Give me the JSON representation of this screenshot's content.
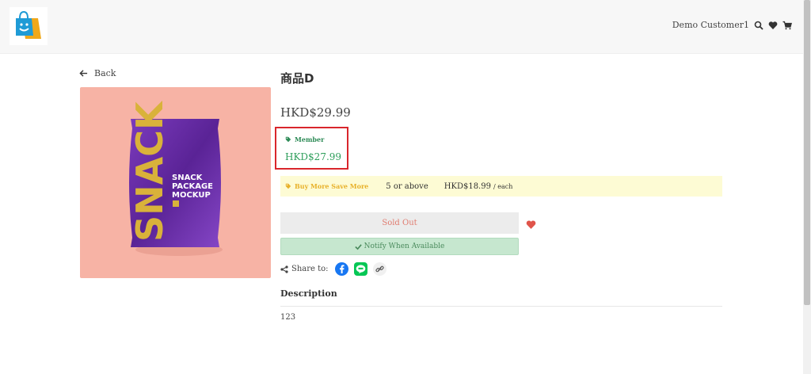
{
  "header": {
    "user_name": "Demo Customer1"
  },
  "product": {
    "back_label": "Back",
    "title": "商品D",
    "price": "HKD$29.99",
    "image_text": {
      "brand_big": "SNACK",
      "line1": "SNACK",
      "line2": "PACKAGE",
      "line3": "MOCKUP"
    }
  },
  "member": {
    "label": "Member",
    "price": "HKD$27.99"
  },
  "bulk": {
    "label": "Buy More Save More",
    "quantity": "5 or above",
    "price": "HKD$18.99",
    "unit": "/ each"
  },
  "actions": {
    "sold_out_label": "Sold Out",
    "notify_label": "Notify When Available"
  },
  "share": {
    "label": "Share to:"
  },
  "description": {
    "title": "Description",
    "text": "123"
  },
  "colors": {
    "member_green": "#2e9e5b",
    "highlight_red": "#d9262c",
    "bulk_yellow": "#e8b12a",
    "image_bg": "#f7b3a5",
    "bag_purple": "#6a2ea8"
  },
  "icons": [
    "shopping-bag-logo",
    "search-icon",
    "heart-icon",
    "cart-icon",
    "arrow-left-icon",
    "tag-icon",
    "check-icon",
    "share-icon",
    "facebook-icon",
    "line-icon",
    "link-icon"
  ]
}
